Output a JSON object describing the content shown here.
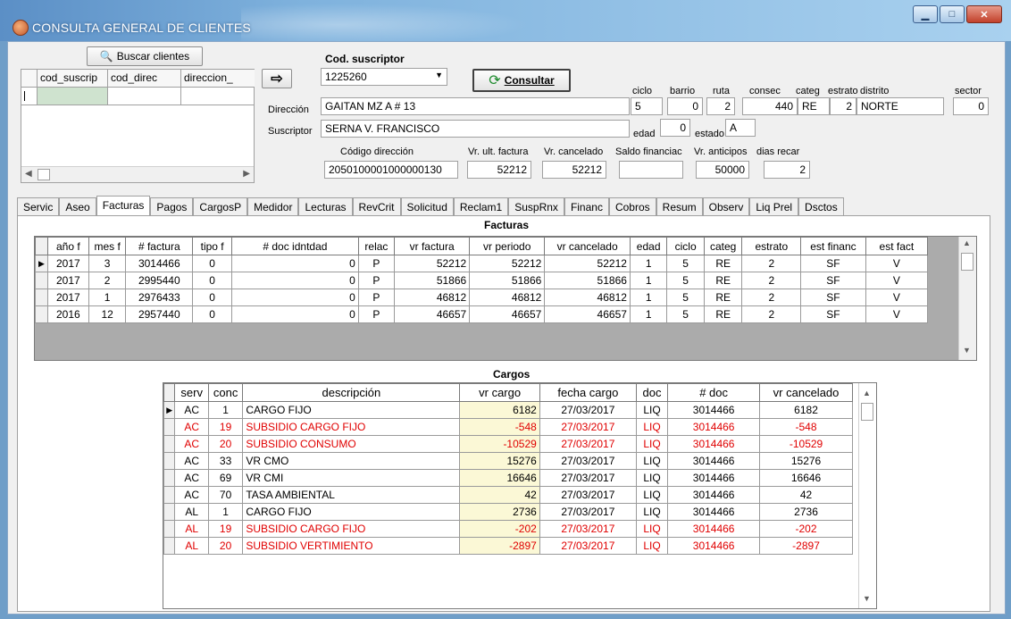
{
  "window": {
    "title": "CONSULTA GENERAL DE CLIENTES"
  },
  "search": {
    "button_label": "Buscar clientes",
    "columns": [
      "cod_suscrip",
      "cod_direc",
      "direccion_"
    ]
  },
  "subscriber": {
    "cod_label": "Cod. suscriptor",
    "cod_value": "1225260",
    "consultar_label": "Consultar",
    "direccion_label": "Dirección",
    "direccion_value": "GAITAN MZ A # 13",
    "suscriptor_label": "Suscriptor",
    "suscriptor_value": "SERNA V. FRANCISCO",
    "codigo_dir_label": "Código dirección",
    "codigo_dir_value": "2050100001000000130",
    "vr_ult_factura_label": "Vr. ult. factura",
    "vr_ult_factura_value": "52212",
    "vr_cancelado_label": "Vr. cancelado",
    "vr_cancelado_value": "52212",
    "saldo_fin_label": "Saldo financiac",
    "saldo_fin_value": "",
    "vr_anticipos_label": "Vr. anticipos",
    "vr_anticipos_value": "50000",
    "dias_recar_label": "dias recar",
    "dias_recar_value": "2",
    "ciclo_label": "ciclo",
    "ciclo_value": "5",
    "barrio_label": "barrio",
    "barrio_value": "0",
    "ruta_label": "ruta",
    "ruta_value": "2",
    "consec_label": "consec",
    "consec_value": "440",
    "categ_label": "categ",
    "categ_value": "RE",
    "estrato_label": "estrato",
    "estrato_value": "2",
    "distrito_label": "distrito",
    "distrito_value": "NORTE",
    "sector_label": "sector",
    "sector_value": "0",
    "edad_label": "edad",
    "edad_value": "0",
    "estado_label": "estado",
    "estado_value": "A"
  },
  "tabs": [
    "Servic",
    "Aseo",
    "Facturas",
    "Pagos",
    "CargosP",
    "Medidor",
    "Lecturas",
    "RevCrit",
    "Solicitud",
    "Reclam1",
    "SuspRnx",
    "Financ",
    "Cobros",
    "Resum",
    "Observ",
    "Liq Prel",
    "Dsctos"
  ],
  "active_tab": "Facturas",
  "facturas": {
    "title": "Facturas",
    "columns": [
      "año f",
      "mes f",
      "# factura",
      "tipo f",
      "# doc idntdad",
      "relac",
      "vr factura",
      "vr periodo",
      "vr cancelado",
      "edad",
      "ciclo",
      "categ",
      "estrato",
      "est financ",
      "est fact"
    ],
    "rows": [
      [
        "2017",
        "3",
        "3014466",
        "0",
        "0",
        "P",
        "52212",
        "52212",
        "52212",
        "1",
        "5",
        "RE",
        "2",
        "SF",
        "V"
      ],
      [
        "2017",
        "2",
        "2995440",
        "0",
        "0",
        "P",
        "51866",
        "51866",
        "51866",
        "1",
        "5",
        "RE",
        "2",
        "SF",
        "V"
      ],
      [
        "2017",
        "1",
        "2976433",
        "0",
        "0",
        "P",
        "46812",
        "46812",
        "46812",
        "1",
        "5",
        "RE",
        "2",
        "SF",
        "V"
      ],
      [
        "2016",
        "12",
        "2957440",
        "0",
        "0",
        "P",
        "46657",
        "46657",
        "46657",
        "1",
        "5",
        "RE",
        "2",
        "SF",
        "V"
      ]
    ]
  },
  "cargos": {
    "title": "Cargos",
    "columns": [
      "serv",
      "conc",
      "descripción",
      "vr cargo",
      "fecha cargo",
      "doc",
      "# doc",
      "vr cancelado"
    ],
    "rows": [
      {
        "cells": [
          "AC",
          "1",
          "CARGO FIJO",
          "6182",
          "27/03/2017",
          "LIQ",
          "3014466",
          "6182"
        ],
        "red": false
      },
      {
        "cells": [
          "AC",
          "19",
          "SUBSIDIO CARGO FIJO",
          "-548",
          "27/03/2017",
          "LIQ",
          "3014466",
          "-548"
        ],
        "red": true
      },
      {
        "cells": [
          "AC",
          "20",
          "SUBSIDIO CONSUMO",
          "-10529",
          "27/03/2017",
          "LIQ",
          "3014466",
          "-10529"
        ],
        "red": true
      },
      {
        "cells": [
          "AC",
          "33",
          "VR CMO",
          "15276",
          "27/03/2017",
          "LIQ",
          "3014466",
          "15276"
        ],
        "red": false
      },
      {
        "cells": [
          "AC",
          "69",
          "VR CMI",
          "16646",
          "27/03/2017",
          "LIQ",
          "3014466",
          "16646"
        ],
        "red": false
      },
      {
        "cells": [
          "AC",
          "70",
          "TASA AMBIENTAL",
          "42",
          "27/03/2017",
          "LIQ",
          "3014466",
          "42"
        ],
        "red": false
      },
      {
        "cells": [
          "AL",
          "1",
          "CARGO FIJO",
          "2736",
          "27/03/2017",
          "LIQ",
          "3014466",
          "2736"
        ],
        "red": false
      },
      {
        "cells": [
          "AL",
          "19",
          "SUBSIDIO CARGO FIJO",
          "-202",
          "27/03/2017",
          "LIQ",
          "3014466",
          "-202"
        ],
        "red": true
      },
      {
        "cells": [
          "AL",
          "20",
          "SUBSIDIO VERTIMIENTO",
          "-2897",
          "27/03/2017",
          "LIQ",
          "3014466",
          "-2897"
        ],
        "red": true
      }
    ]
  },
  "colors": {
    "negative": "#e00000",
    "highlight": "#fbf8d6",
    "title_bar": "#5b8fc6"
  }
}
